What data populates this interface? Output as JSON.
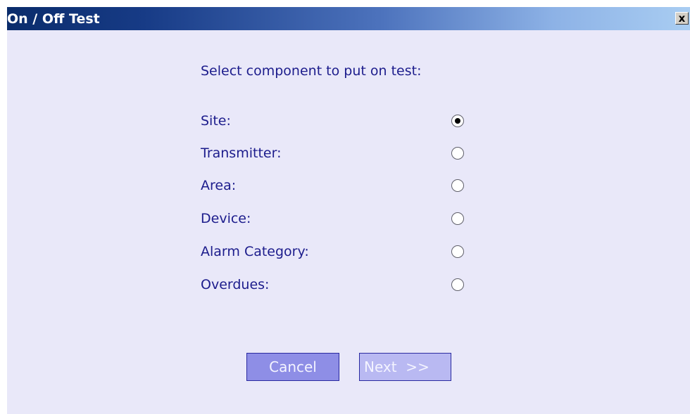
{
  "dialog": {
    "title": "On / Off Test",
    "close_label": "x",
    "prompt": "Select component to put on test:",
    "options": [
      {
        "label": "Site:",
        "selected": true
      },
      {
        "label": "Transmitter:",
        "selected": false
      },
      {
        "label": "Area:",
        "selected": false
      },
      {
        "label": "Device:",
        "selected": false
      },
      {
        "label": "Alarm Category:",
        "selected": false
      },
      {
        "label": "Overdues:",
        "selected": false
      }
    ],
    "buttons": {
      "cancel": "Cancel",
      "next": "Next  >>"
    }
  },
  "colors": {
    "background": "#e9e8f9",
    "text": "#1c1c8c",
    "cancel_button": "#8e8ee6",
    "next_button": "#b9b9f2",
    "titlebar_dark": "#0a2c6b",
    "titlebar_light": "#a9cdf2"
  }
}
